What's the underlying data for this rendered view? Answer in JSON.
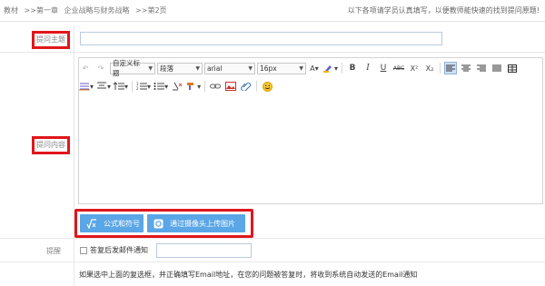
{
  "breadcrumb": {
    "items": [
      "教材",
      ">>第一章",
      "企业战略与财务战略",
      ">>第2页"
    ]
  },
  "hint": "以下各项请学员认真填写，以便教师能快速的找到提问原题!",
  "subject": {
    "label": "提问主题",
    "value": ""
  },
  "content": {
    "label": "提问内容"
  },
  "toolbar": {
    "title_select": "自定义标题",
    "paragraph_select": "段落",
    "font_select": "arial",
    "size_select": "16px",
    "bold": "B",
    "italic": "I",
    "underline": "U",
    "strike": "ABC",
    "superscript": "X²",
    "subscript": "X₂"
  },
  "buttons": {
    "formula": "公式和符号",
    "camera": "通过摄像头上传图片"
  },
  "remind": {
    "label": "提醒",
    "checkbox_label": "答复后发邮件通知",
    "email_value": ""
  },
  "note": "如果选中上面的复选框，并正确填写Email地址，在您的问题被答复时，将收到系统自动发送的Email通知",
  "colors": {
    "highlight_border": "#e0161b",
    "action_button": "#5aa6e6",
    "input_border": "#b9cbe0"
  }
}
